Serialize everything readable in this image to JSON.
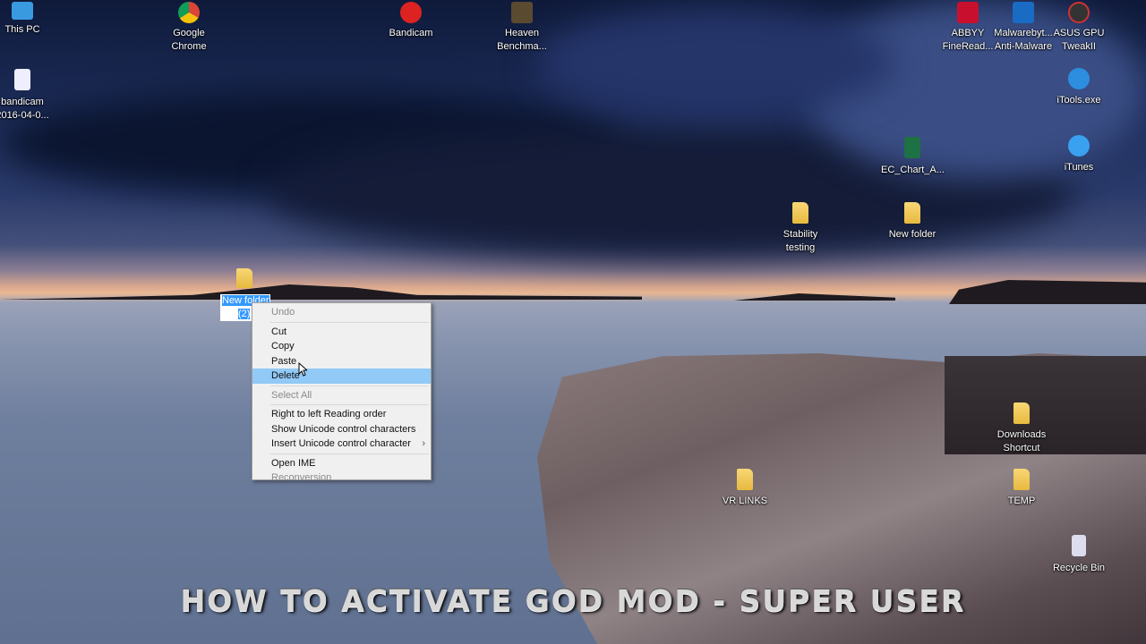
{
  "desktop_icons": [
    {
      "label": "This PC",
      "glyph": "computer-icon"
    },
    {
      "label": "bandicam 2016-04-0...",
      "glyph": "video-file-icon"
    },
    {
      "label": "Google Chrome",
      "glyph": "chrome-icon"
    },
    {
      "label": "Bandicam",
      "glyph": "bandicam-icon"
    },
    {
      "label": "Heaven Benchma...",
      "glyph": "heaven-icon"
    },
    {
      "label": "ABBYY FineRead...",
      "glyph": "abbyy-icon"
    },
    {
      "label": "Malwarebyt... Anti-Malware",
      "glyph": "malwarebytes-icon"
    },
    {
      "label": "ASUS GPU TweakII",
      "glyph": "asus-icon"
    },
    {
      "label": "iTools.exe",
      "glyph": "itools-icon"
    },
    {
      "label": "iTunes",
      "glyph": "itunes-icon"
    },
    {
      "label": "EC_Chart_A...",
      "glyph": "excel-icon"
    },
    {
      "label": "Stability testing",
      "glyph": "folder-icon"
    },
    {
      "label": "New folder",
      "glyph": "folder-icon"
    },
    {
      "label": "Downloads Shortcut",
      "glyph": "folder-shortcut-icon"
    },
    {
      "label": "VR LINKS",
      "glyph": "folder-icon"
    },
    {
      "label": "TEMP",
      "glyph": "folder-icon"
    },
    {
      "label": "Recycle Bin",
      "glyph": "recycle-bin-icon"
    }
  ],
  "editing_icon": {
    "line1": "New folder",
    "line2": "(2)"
  },
  "context_menu": {
    "undo": "Undo",
    "cut": "Cut",
    "copy": "Copy",
    "paste": "Paste",
    "delete": "Delete",
    "select_all": "Select All",
    "rtl": "Right to left Reading order",
    "show_unicode": "Show Unicode control characters",
    "insert_unicode": "Insert Unicode control character",
    "submenu_arrow": "›",
    "open_ime": "Open IME",
    "reconversion": "Reconversion"
  },
  "overlay_title": "HOW TO ACTIVATE GOD MOD - SUPER USER"
}
